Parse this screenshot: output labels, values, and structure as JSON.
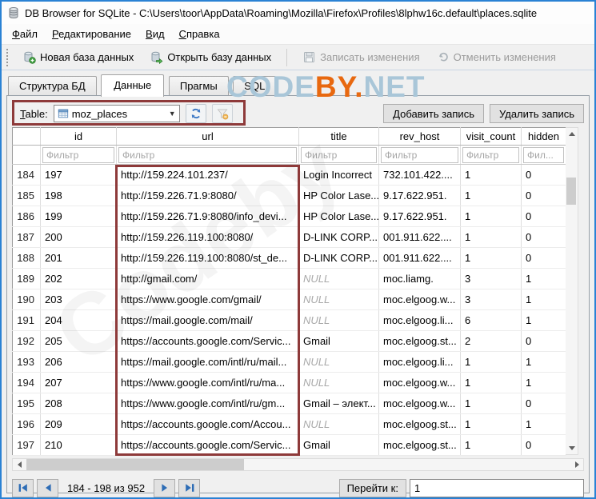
{
  "colors": {
    "annotation_red": "#8e3a3a",
    "logo_blue": "#a9c6d8",
    "logo_orange": "#e8680f",
    "win_border": "#2a82d4"
  },
  "window": {
    "title": "DB Browser for SQLite - C:\\Users\\toor\\AppData\\Roaming\\Mozilla\\Firefox\\Profiles\\8lphw16c.default\\places.sqlite"
  },
  "menu": {
    "file": "Файл",
    "edit": "Редактирование",
    "view": "Вид",
    "help": "Справка"
  },
  "toolbar": {
    "new_db": "Новая база данных",
    "open_db": "Открыть базу данных",
    "write_changes": "Записать изменения",
    "revert_changes": "Отменить изменения"
  },
  "tabs": {
    "structure": "Структура БД",
    "data": "Данные",
    "pragmas": "Прагмы",
    "sql": "SQL"
  },
  "logo": {
    "part1": "CODE",
    "part2": "BY.",
    "part3": "NET"
  },
  "diag_watermark": "Codeby",
  "table_controls": {
    "label": "Table:",
    "selected_table": "moz_places",
    "combo_arrow": "▼",
    "add_record": "Добавить запись",
    "delete_record": "Удалить запись"
  },
  "grid": {
    "columns": {
      "id": "id",
      "url": "url",
      "title": "title",
      "rev_host": "rev_host",
      "visit_count": "visit_count",
      "hidden": "hidden"
    },
    "filter_placeholder": "Фильтр",
    "filter_placeholder_short": "Фил...",
    "rows": [
      {
        "n": "184",
        "id": "197",
        "url": "http://159.224.101.237/",
        "title": "Login Incorrect",
        "title_null": false,
        "rev_host": "732.101.422....",
        "visit_count": "1",
        "hidden": "0"
      },
      {
        "n": "185",
        "id": "198",
        "url": "http://159.226.71.9:8080/",
        "title": "HP Color Lase...",
        "title_null": false,
        "rev_host": "9.17.622.951.",
        "visit_count": "1",
        "hidden": "0"
      },
      {
        "n": "186",
        "id": "199",
        "url": "http://159.226.71.9:8080/info_devi...",
        "title": "HP Color Lase...",
        "title_null": false,
        "rev_host": "9.17.622.951.",
        "visit_count": "1",
        "hidden": "0"
      },
      {
        "n": "187",
        "id": "200",
        "url": "http://159.226.119.100:8080/",
        "title": "D-LINK CORP...",
        "title_null": false,
        "rev_host": "001.911.622....",
        "visit_count": "1",
        "hidden": "0"
      },
      {
        "n": "188",
        "id": "201",
        "url": "http://159.226.119.100:8080/st_de...",
        "title": "D-LINK CORP...",
        "title_null": false,
        "rev_host": "001.911.622....",
        "visit_count": "1",
        "hidden": "0"
      },
      {
        "n": "189",
        "id": "202",
        "url": "http://gmail.com/",
        "title": "NULL",
        "title_null": true,
        "rev_host": "moc.liamg.",
        "visit_count": "3",
        "hidden": "1"
      },
      {
        "n": "190",
        "id": "203",
        "url": "https://www.google.com/gmail/",
        "title": "NULL",
        "title_null": true,
        "rev_host": "moc.elgoog.w...",
        "visit_count": "3",
        "hidden": "1"
      },
      {
        "n": "191",
        "id": "204",
        "url": "https://mail.google.com/mail/",
        "title": "NULL",
        "title_null": true,
        "rev_host": "moc.elgoog.li...",
        "visit_count": "6",
        "hidden": "1"
      },
      {
        "n": "192",
        "id": "205",
        "url": "https://accounts.google.com/Servic...",
        "title": "Gmail",
        "title_null": false,
        "rev_host": "moc.elgoog.st...",
        "visit_count": "2",
        "hidden": "0"
      },
      {
        "n": "193",
        "id": "206",
        "url": "https://mail.google.com/intl/ru/mail...",
        "title": "NULL",
        "title_null": true,
        "rev_host": "moc.elgoog.li...",
        "visit_count": "1",
        "hidden": "1"
      },
      {
        "n": "194",
        "id": "207",
        "url": "https://www.google.com/intl/ru/ma...",
        "title": "NULL",
        "title_null": true,
        "rev_host": "moc.elgoog.w...",
        "visit_count": "1",
        "hidden": "1"
      },
      {
        "n": "195",
        "id": "208",
        "url": "https://www.google.com/intl/ru/gm...",
        "title": "Gmail – элект...",
        "title_null": false,
        "rev_host": "moc.elgoog.w...",
        "visit_count": "1",
        "hidden": "0"
      },
      {
        "n": "196",
        "id": "209",
        "url": "https://accounts.google.com/Accou...",
        "title": "NULL",
        "title_null": true,
        "rev_host": "moc.elgoog.st...",
        "visit_count": "1",
        "hidden": "1"
      },
      {
        "n": "197",
        "id": "210",
        "url": "https://accounts.google.com/Servic...",
        "title": "Gmail",
        "title_null": false,
        "rev_host": "moc.elgoog.st...",
        "visit_count": "1",
        "hidden": "0"
      }
    ]
  },
  "pagination": {
    "range_label": "184 - 198 из 952",
    "goto_label": "Перейти к:",
    "goto_value": "1"
  }
}
